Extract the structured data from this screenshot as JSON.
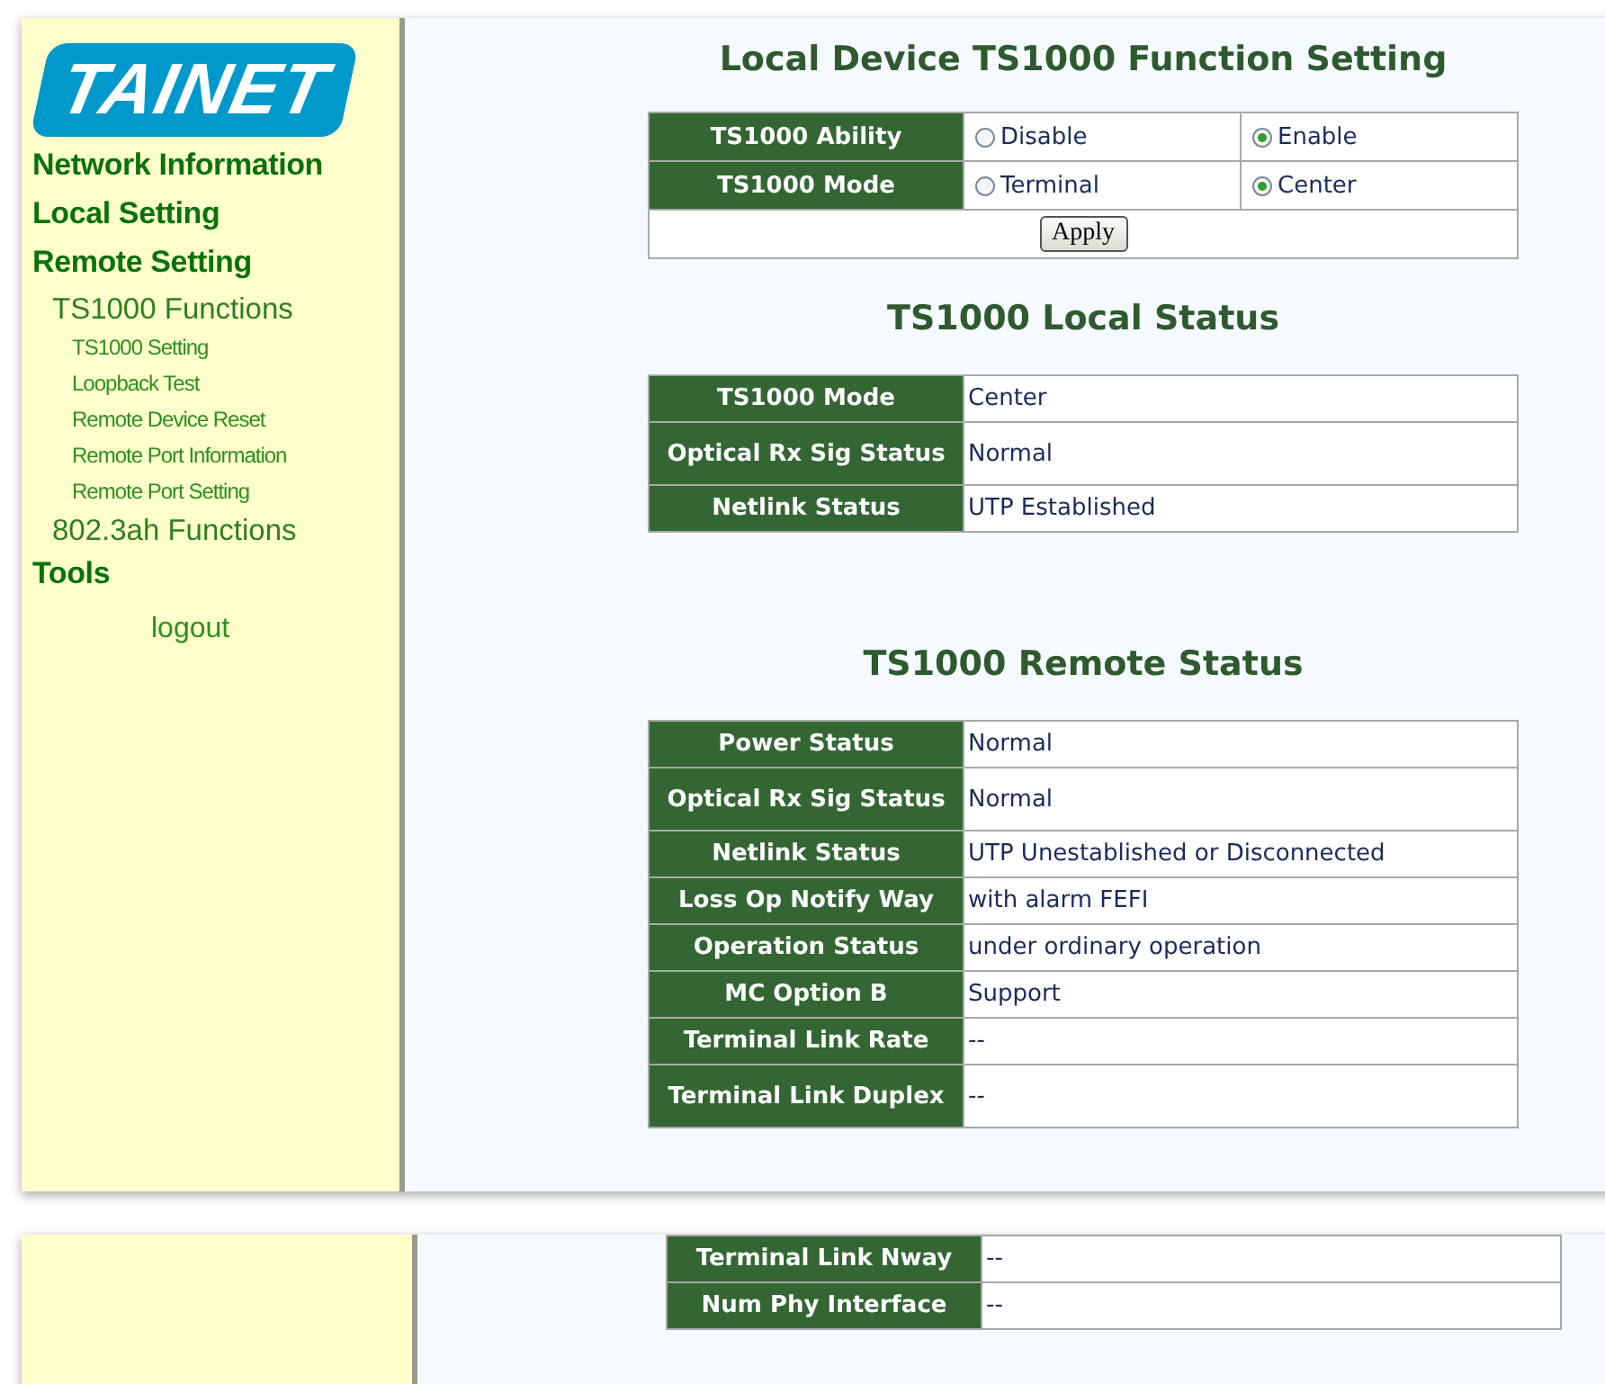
{
  "logo": {
    "text": "TAINET"
  },
  "sidebar": {
    "items": [
      {
        "label": "Network Information"
      },
      {
        "label": "Local Setting"
      },
      {
        "label": "Remote Setting",
        "children": [
          {
            "label": "TS1000 Functions",
            "children": [
              {
                "label": "TS1000 Setting"
              },
              {
                "label": "Loopback Test"
              },
              {
                "label": "Remote Device Reset"
              },
              {
                "label": "Remote Port Information"
              },
              {
                "label": "Remote Port Setting"
              }
            ]
          },
          {
            "label": "802.3ah Functions"
          }
        ]
      },
      {
        "label": "Tools"
      }
    ],
    "logout": "logout"
  },
  "function_setting": {
    "title": "Local Device TS1000 Function Setting",
    "rows": [
      {
        "label": "TS1000 Ability",
        "options": [
          {
            "label": "Disable",
            "selected": false
          },
          {
            "label": "Enable",
            "selected": true
          }
        ]
      },
      {
        "label": "TS1000 Mode",
        "options": [
          {
            "label": "Terminal",
            "selected": false
          },
          {
            "label": "Center",
            "selected": true
          }
        ]
      }
    ],
    "button": "Apply"
  },
  "local_status": {
    "title": "TS1000 Local Status",
    "rows": [
      {
        "label": "TS1000 Mode",
        "value": "Center"
      },
      {
        "label": "Optical Rx Sig Status",
        "value": "Normal"
      },
      {
        "label": "Netlink Status",
        "value": "UTP Established"
      }
    ]
  },
  "remote_status": {
    "title": "TS1000 Remote Status",
    "rows": [
      {
        "label": "Power Status",
        "value": "Normal"
      },
      {
        "label": "Optical Rx Sig Status",
        "value": "Normal"
      },
      {
        "label": "Netlink Status",
        "value": "UTP Unestablished or Disconnected"
      },
      {
        "label": "Loss Op Notify Way",
        "value": "with alarm FEFI"
      },
      {
        "label": "Operation Status",
        "value": "under ordinary operation"
      },
      {
        "label": "MC Option B",
        "value": "Support"
      },
      {
        "label": "Terminal Link Rate",
        "value": "--"
      },
      {
        "label": "Terminal Link Duplex",
        "value": "--"
      }
    ]
  },
  "remote_status_continued": {
    "rows": [
      {
        "label": "Terminal Link Nway",
        "value": "--"
      },
      {
        "label": "Num Phy Interface",
        "value": "--"
      }
    ]
  }
}
